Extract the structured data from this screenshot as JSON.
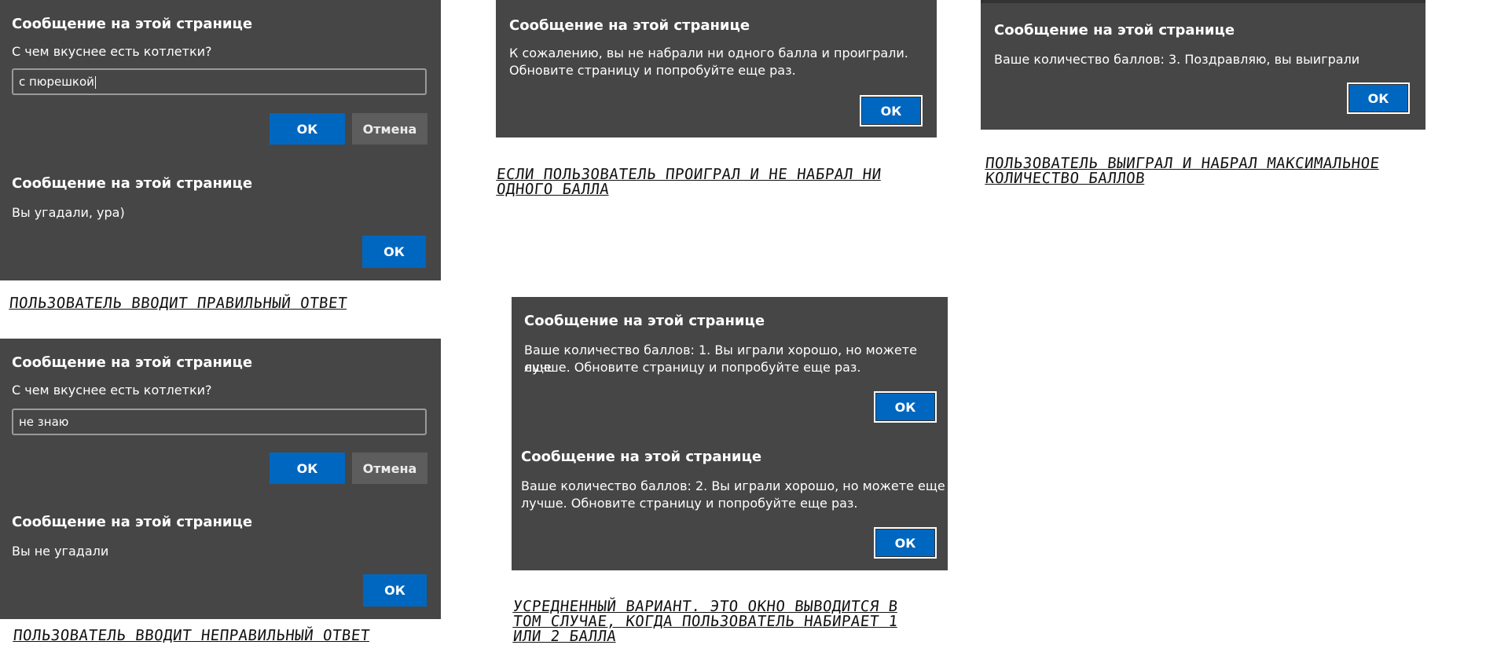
{
  "dialog_title": "Сообщение на этой странице",
  "ok_label": "ОК",
  "cancel_label": "Отмена",
  "prompt_correct": {
    "question": "С чем вкуснее есть котлетки?",
    "input_value": "с пюрешкой"
  },
  "alert_correct": {
    "message": "Вы угадали, ура)"
  },
  "caption_correct": "Пользователь вводит правильный ответ",
  "prompt_wrong": {
    "question": "С чем вкуснее есть котлетки?",
    "input_value": "не знаю"
  },
  "alert_wrong": {
    "message": "Вы не угадали"
  },
  "caption_wrong": "Пользователь вводит неправильный ответ",
  "alert_lost": {
    "message_line1": "К сожалению, вы не набрали ни одного балла и проиграли.",
    "message_line2": "Обновите страницу и попробуйте еще раз."
  },
  "caption_lost": {
    "line1": "Если пользователь проиграл и не набрал ни",
    "line2": "одного балла"
  },
  "alert_won": {
    "message": "Ваше количество баллов: 3. Поздравляю, вы выиграли"
  },
  "caption_won": {
    "line1": "Пользователь выиграл и набрал максимальное",
    "line2": "количество баллов"
  },
  "alert_score1": {
    "message_line1": "Ваше количество баллов: 1. Вы играли хорошо, но можете еще",
    "message_line2": "лучше. Обновите страницу и попробуйте еще раз."
  },
  "alert_score2": {
    "message_line1": "Ваше количество баллов: 2. Вы играли хорошо, но можете еще",
    "message_line2": "лучше. Обновите страницу и попробуйте еще раз."
  },
  "caption_average": {
    "line1": "Усредненный вариант. Это окно выводится в",
    "line2": "том случае, когда пользователь набирает 1",
    "line3": "или 2 балла"
  },
  "colors": {
    "dialog_bg": "#464646",
    "ok_button": "#0067c0",
    "cancel_button": "#5d5d5d",
    "page_bg": "#ffffff"
  }
}
